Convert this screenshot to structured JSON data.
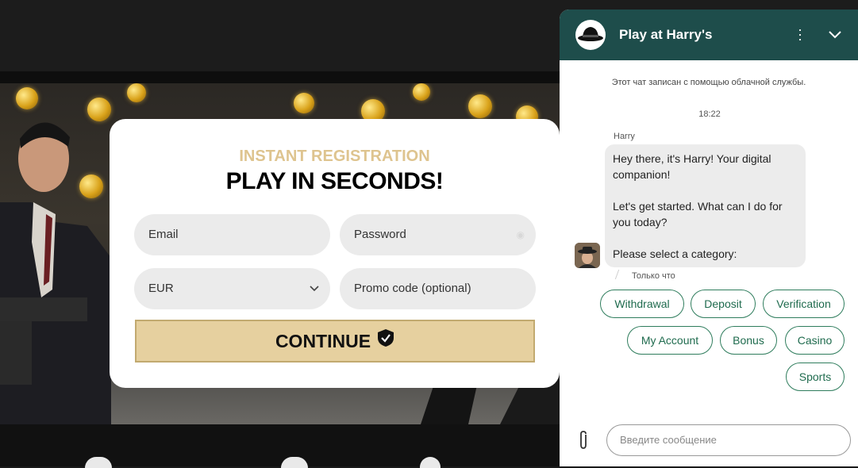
{
  "registration": {
    "subtitle": "INSTANT REGISTRATION",
    "title": "PLAY IN SECONDS!",
    "email_placeholder": "Email",
    "password_placeholder": "Password",
    "currency_value": "EUR",
    "promo_placeholder": "Promo code (optional)",
    "continue_label": "CONTINUE"
  },
  "chat": {
    "header_title": "Play at Harry's",
    "recorded_notice": "Этот чат записан с помощью облачной службы.",
    "time": "18:22",
    "sender": "Harry",
    "message_p1": "Hey there, it's Harry! Your digital companion!",
    "message_p2": "Let's get started. What can I do for you today?",
    "message_p3": "Please select a category:",
    "status": "Только что",
    "categories": [
      "Withdrawal",
      "Deposit",
      "Verification",
      "My Account",
      "Bonus",
      "Casino",
      "Sports"
    ],
    "input_placeholder": "Введите сообщение"
  },
  "colors": {
    "accent_gold": "#dec48f",
    "chat_header": "#1e4d4b",
    "chip_green": "#2f7d5d"
  }
}
